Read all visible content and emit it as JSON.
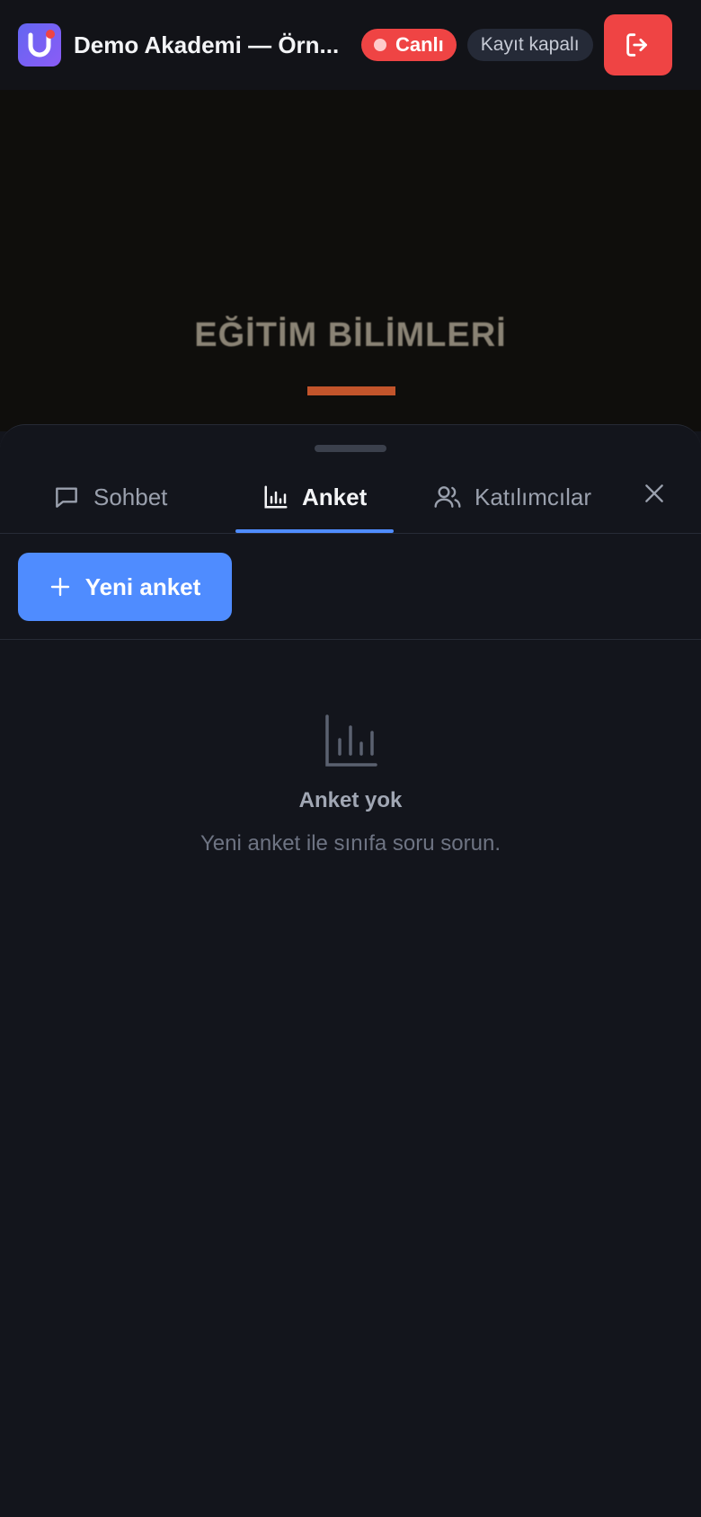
{
  "header": {
    "app_title": "Demo Akademi — Örn...",
    "live_label": "Canlı",
    "recording_label": "Kayıt kapalı",
    "colors": {
      "live": "#ef4444",
      "leave": "#ef4444",
      "accent": "#4f8cff"
    }
  },
  "video": {
    "slide_title": "EĞİTİM BİLİMLERİ"
  },
  "sheet": {
    "tabs": [
      {
        "label": "Sohbet",
        "icon": "chat-icon",
        "active": false
      },
      {
        "label": "Anket",
        "icon": "bar-chart-icon",
        "active": true
      },
      {
        "label": "Katılımcılar",
        "icon": "users-icon",
        "active": false
      }
    ],
    "new_poll_label": "Yeni anket",
    "empty_state": {
      "icon": "bar-chart-icon",
      "title": "Anket yok",
      "text": "Yeni anket ile sınıfa soru sorun."
    }
  }
}
